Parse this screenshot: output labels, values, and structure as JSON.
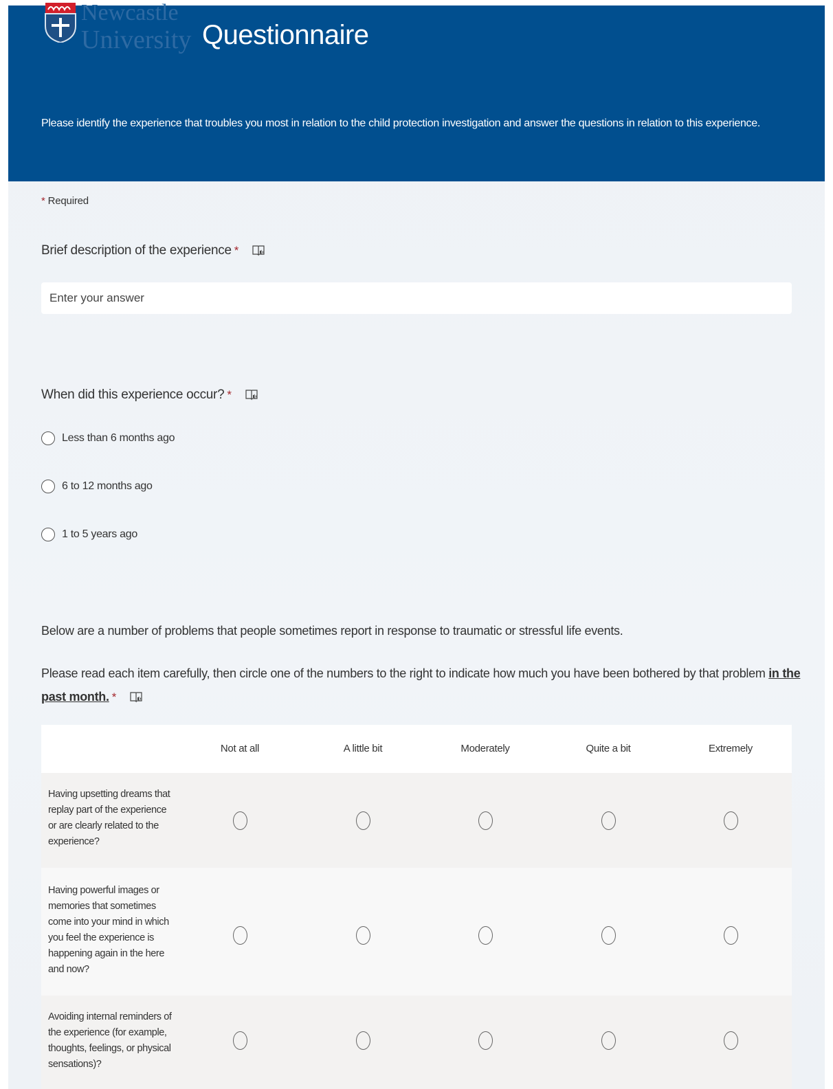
{
  "header": {
    "logo_line1": "Newcastle",
    "logo_line2": "University",
    "title": "Questionnaire",
    "description": "Please identify the experience that troubles you most in relation to the child protection investigation and answer the questions in relation to this experience."
  },
  "required_note": "Required",
  "q1": {
    "title": "Brief description of the experience",
    "placeholder": "Enter your answer"
  },
  "q2": {
    "title": "When did this experience occur?",
    "options": [
      "Less than 6 months ago",
      "6 to 12 months ago",
      "1 to 5 years ago"
    ]
  },
  "q3": {
    "intro": "Below are a number of problems that people sometimes report in response to traumatic or stressful life events.",
    "instruction_part1": "Please read each item carefully, then circle one of the numbers to the right to indicate how much you have been bothered by that problem",
    "instruction_emphasis_line1": "in the",
    "instruction_emphasis_line2": "past month.",
    "columns": [
      "Not at all",
      "A little bit",
      "Moderately",
      "Quite a bit",
      "Extremely"
    ],
    "rows": [
      [
        "Having upsetting dreams that",
        "replay part of the experience",
        "or are clearly related to the",
        "experience?"
      ],
      [
        "Having powerful images or",
        "memories that sometimes",
        "come into your mind in which",
        "you feel the experience is",
        "happening again in the here",
        "and now?"
      ],
      [
        "Avoiding internal reminders of",
        "the experience (for example,",
        "thoughts, feelings, or physical",
        "sensations)?"
      ]
    ]
  },
  "star": "*",
  "icons": {
    "reader": "immersive-reader-icon",
    "radio": "radio-empty"
  },
  "colors": {
    "banner": "#014f8f",
    "required": "#a4262c",
    "page_bg": "#eef2f6"
  }
}
